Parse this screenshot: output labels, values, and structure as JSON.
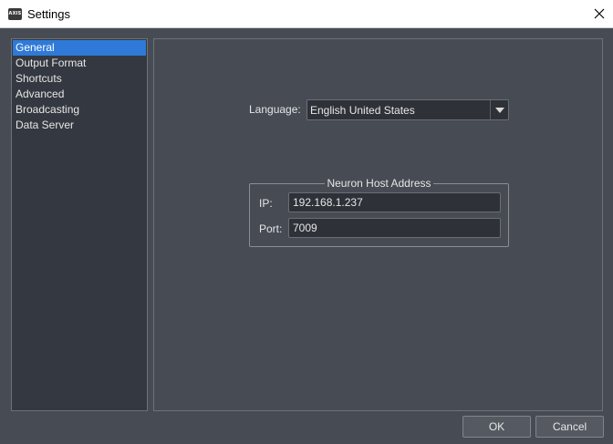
{
  "window": {
    "title": "Settings",
    "icon_text": "AXIS"
  },
  "nav": {
    "items": [
      {
        "label": "General",
        "selected": true
      },
      {
        "label": "Output Format"
      },
      {
        "label": "Shortcuts"
      },
      {
        "label": "Advanced"
      },
      {
        "label": "Broadcasting"
      },
      {
        "label": "Data Server"
      }
    ]
  },
  "general": {
    "language_label": "Language:",
    "language_value": "English United States",
    "host_group_title": "Neuron Host Address",
    "ip_label": "IP:",
    "ip_value": "192.168.1.237",
    "port_label": "Port:",
    "port_value": "7009"
  },
  "footer": {
    "ok_label": "OK",
    "cancel_label": "Cancel"
  },
  "colors": {
    "background": "#464b54",
    "nav_background": "#343840",
    "selection": "#2f7ad8",
    "input_background": "#2e3238"
  }
}
